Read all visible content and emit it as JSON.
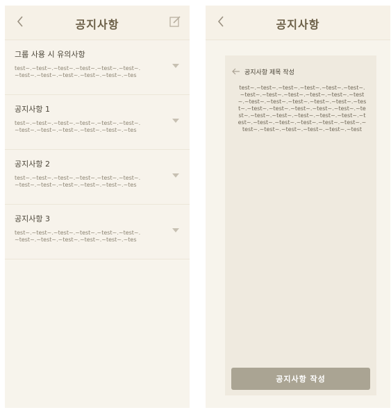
{
  "left_screen": {
    "title": "공지사항",
    "items": [
      {
        "title": "그룹 사용 시 유의사항",
        "lines": [
          "test~.~test~.~test~.~test~.~test~.~test~.",
          "~test~.~test~.~test~.~test~.~test~.~tes"
        ]
      },
      {
        "title": "공지사항 1",
        "lines": [
          "test~.~test~.~test~.~test~.~test~.~test~.",
          "~test~.~test~.~test~.~test~.~test~.~tes"
        ]
      },
      {
        "title": "공지사항 2",
        "lines": [
          "test~.~test~.~test~.~test~.~test~.~test~.",
          "~test~.~test~.~test~.~test~.~test~.~tes"
        ]
      },
      {
        "title": "공지사항 3",
        "lines": [
          "test~.~test~.~test~.~test~.~test~.~test~.",
          "~test~.~test~.~test~.~test~.~test~.~tes"
        ]
      }
    ]
  },
  "right_screen": {
    "title": "공지사항",
    "card_title": "공지사항 제목 작성",
    "card_lines": [
      "test~.~test~.~test~.~test~.~test~.~test~.",
      "~test~.~test~.~test~.~test~.~test~.~test",
      "~.~test~.~test~.~test~.~test~.~test~.~tes",
      "t~.~test~.~test~.~test~.~test~.~test~.~te",
      "st~.~test~.~test~.~test~.~test~.~test~.~t",
      "est~.~test~.~test~.~test~.~test~.~test~.~",
      "test~.~test~.~test~.~test~.~test~.~test"
    ],
    "submit_label": "공지사항 작성"
  },
  "icons": {
    "back": "chevron-left-icon",
    "edit": "edit-icon",
    "expand": "caret-down-icon",
    "card_back": "arrow-left-icon"
  },
  "colors": {
    "background": "#f7f4ec",
    "title": "#6b5f47",
    "button": "#aaa493"
  }
}
